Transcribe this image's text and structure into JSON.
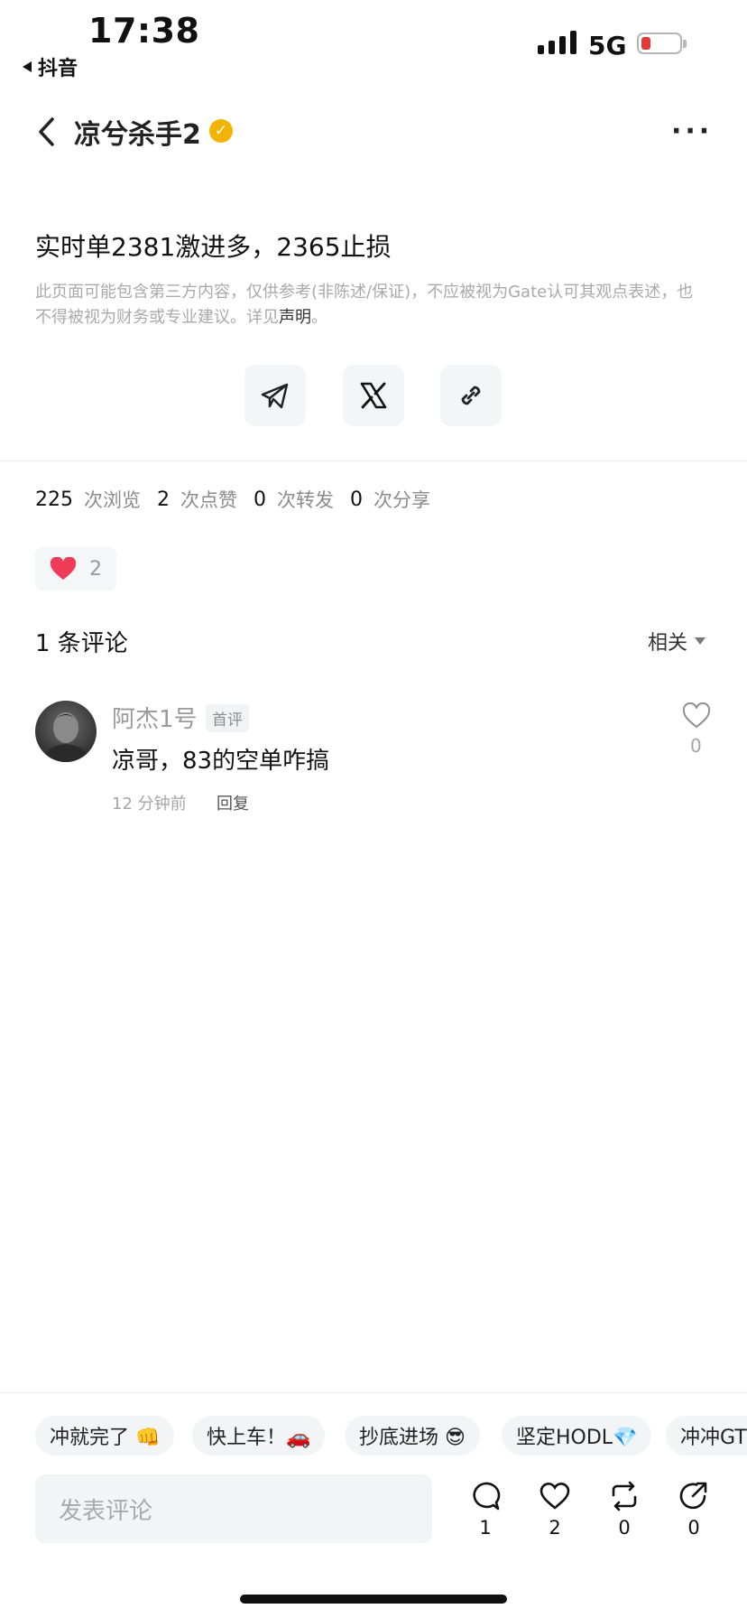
{
  "status_bar": {
    "time": "17:38",
    "back_app": "抖音",
    "network": "5G",
    "battery_color": "#e53935"
  },
  "header": {
    "author": "凉兮杀手2",
    "verified_icon": "verified-badge-icon",
    "more_icon": "more-dots-icon"
  },
  "post": {
    "text": "实时单2381激进多，2365止损",
    "disclaimer": "此页面可能包含第三方内容，仅供参考(非陈述/保证)，不应被视为Gate认可其观点表述，也不得被视为财务或专业建议。详见",
    "disclaimer_link": "声明",
    "disclaimer_end": "。"
  },
  "share_icons": [
    "telegram-icon",
    "x-icon",
    "link-icon"
  ],
  "stats": {
    "views_n": "225",
    "views_label": "次浏览",
    "likes_n": "2",
    "likes_label": "次点赞",
    "reposts_n": "0",
    "reposts_label": "次转发",
    "shares_n": "0",
    "shares_label": "次分享"
  },
  "reaction": {
    "count": "2",
    "color": "#ef3b57"
  },
  "comments_section": {
    "count_label": "1 条评论",
    "sort_label": "相关"
  },
  "comment": {
    "user": "阿杰1号",
    "badge": "首评",
    "text": "凉哥，83的空单咋搞",
    "time": "12 分钟前",
    "reply": "回复",
    "likes": "0"
  },
  "quick_replies": [
    "冲就完了 👊",
    "快上车！🚗",
    "抄底进场 😎",
    "坚定HODL💎",
    "冲冲GT"
  ],
  "composer": {
    "placeholder": "发表评论"
  },
  "actions": {
    "comments": "1",
    "likes": "2",
    "reposts": "0",
    "shares": "0"
  }
}
